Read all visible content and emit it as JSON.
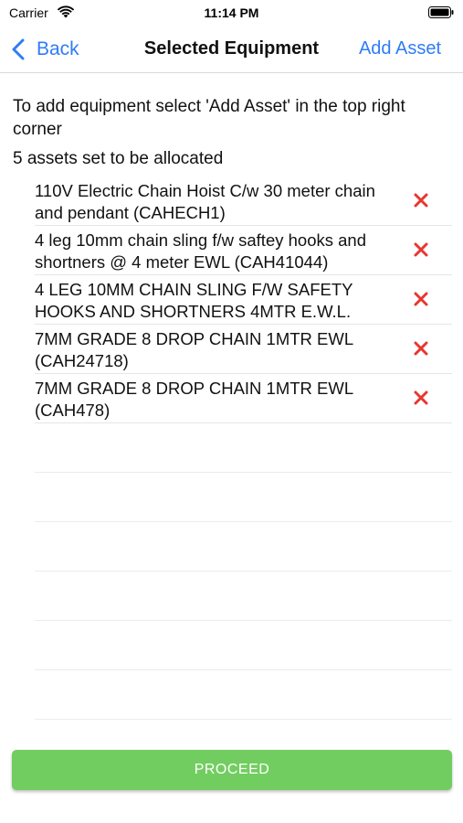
{
  "status_bar": {
    "carrier": "Carrier",
    "time": "11:14 PM",
    "wifi_icon": "wifi-icon",
    "battery_icon": "battery-icon"
  },
  "nav": {
    "back_label": "Back",
    "back_icon": "chevron-left-icon",
    "title": "Selected Equipment",
    "add_asset_label": "Add Asset",
    "accent_color": "#2f7cf6"
  },
  "instructions": "To add equipment select 'Add Asset' in the top right corner",
  "asset_count_text": "5 assets set to be allocated",
  "assets": [
    {
      "name": "110V Electric Chain Hoist C/w 30 meter chain and pendant  (CAHECH1)"
    },
    {
      "name": "4 leg 10mm chain sling f/w saftey hooks and shortners @ 4 meter EWL (CAH41044)"
    },
    {
      "name": "4 LEG 10MM CHAIN SLING F/W SAFETY HOOKS AND SHORTNERS 4MTR E.W.L."
    },
    {
      "name": "7MM GRADE 8 DROP CHAIN 1MTR EWL (CAH24718)"
    },
    {
      "name": "7MM GRADE 8 DROP CHAIN 1MTR EWL (CAH478)"
    }
  ],
  "remove_icon": "close-icon",
  "remove_color": "#e8362f",
  "proceed_label": "PROCEED",
  "proceed_color": "#72cd60"
}
